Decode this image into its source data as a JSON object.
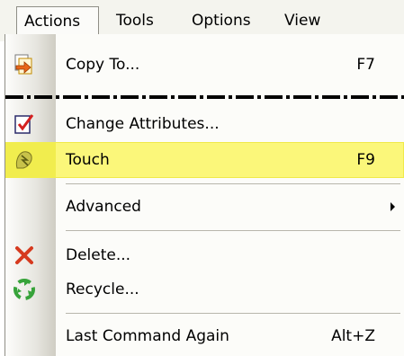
{
  "menubar": {
    "menus": [
      {
        "label": "Actions"
      },
      {
        "label": "Tools"
      },
      {
        "label": "Options"
      },
      {
        "label": "View"
      }
    ]
  },
  "dropdown": {
    "items": [
      {
        "label": "Copy To...",
        "shortcut": "F7",
        "icon": "copy-to-icon"
      },
      {
        "label": "Change Attributes...",
        "shortcut": "",
        "icon": "change-attributes-icon"
      },
      {
        "label": "Touch",
        "shortcut": "F9",
        "icon": "touch-icon",
        "highlighted": true
      },
      {
        "label": "Advanced",
        "shortcut": "",
        "icon": "",
        "submenu": true
      },
      {
        "label": "Delete...",
        "shortcut": "",
        "icon": "delete-icon"
      },
      {
        "label": "Recycle...",
        "shortcut": "",
        "icon": "recycle-icon"
      },
      {
        "label": "Last Command Again",
        "shortcut": "Alt+Z",
        "icon": ""
      }
    ]
  },
  "colors": {
    "highlight": "#fbf77a",
    "menubar_bg": "#f4f4ee",
    "delete_red": "#d63a1f",
    "recycle_green": "#37a33a"
  }
}
